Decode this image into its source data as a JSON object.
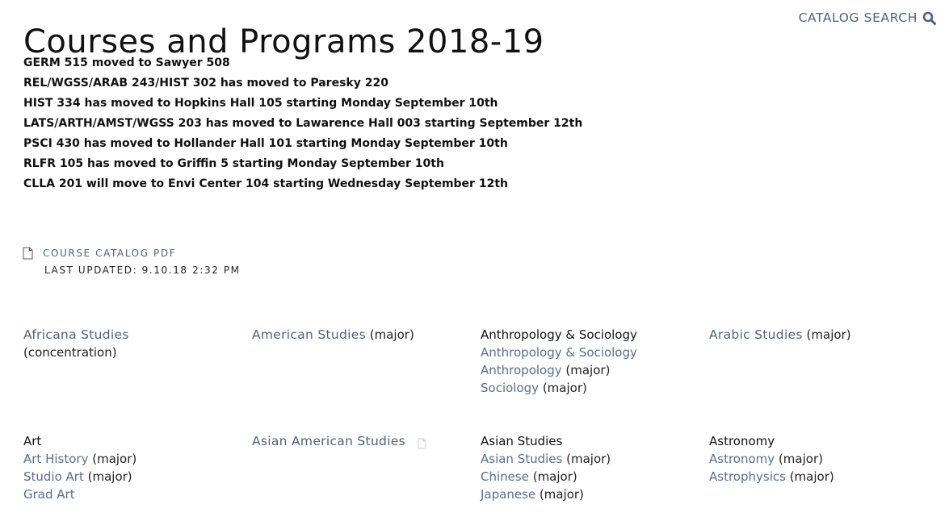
{
  "page": {
    "title": "Courses and Programs 2018-19",
    "catalog_search_label": "CATALOG SEARCH",
    "search_icon": "search-icon"
  },
  "notices": [
    "GERM 515 moved to Sawyer 508",
    "REL/WGSS/ARAB 243/HIST 302 has moved to Paresky 220",
    "HIST 334 has moved to Hopkins Hall 105 starting Monday September 10th",
    "LATS/ARTH/AMST/WGSS 203 has moved to Lawarence Hall 003 starting September 12th",
    "PSCI 430 has moved to Hollander Hall 101 starting Monday September 10th",
    "RLFR 105 has moved to Griffin 5 starting Monday September 10th",
    "CLLA 201 will move to Envi Center 104 starting Wednesday September 12th"
  ],
  "pdf": {
    "label": "COURSE CATALOG PDF",
    "last_updated": "LAST UPDATED: 9.10.18 2:32 PM",
    "icon": "document-icon"
  },
  "programs": {
    "africana": {
      "title": "Africana Studies",
      "note": "(concentration)"
    },
    "american": {
      "title": "American Studies",
      "note": "(major)"
    },
    "anthro": {
      "title": "Anthropology & Sociology",
      "items": [
        {
          "label": "Anthropology & Sociology",
          "note": ""
        },
        {
          "label": "Anthropology",
          "note": "(major)"
        },
        {
          "label": "Sociology",
          "note": "(major)"
        }
      ]
    },
    "arabic": {
      "title": "Arabic Studies",
      "note": "(major)"
    },
    "art": {
      "title": "Art",
      "items": [
        {
          "label": "Art History",
          "note": "(major)"
        },
        {
          "label": "Studio Art",
          "note": "(major)"
        },
        {
          "label": "Grad Art",
          "note": ""
        }
      ]
    },
    "asian_american": {
      "title": "Asian American Studies"
    },
    "asian": {
      "title": "Asian Studies",
      "items": [
        {
          "label": "Asian Studies",
          "note": "(major)"
        },
        {
          "label": "Chinese",
          "note": "(major)"
        },
        {
          "label": "Japanese",
          "note": "(major)"
        }
      ]
    },
    "astronomy": {
      "title": "Astronomy",
      "items": [
        {
          "label": "Astronomy",
          "note": "(major)"
        },
        {
          "label": "Astrophysics",
          "note": "(major)"
        }
      ]
    }
  }
}
